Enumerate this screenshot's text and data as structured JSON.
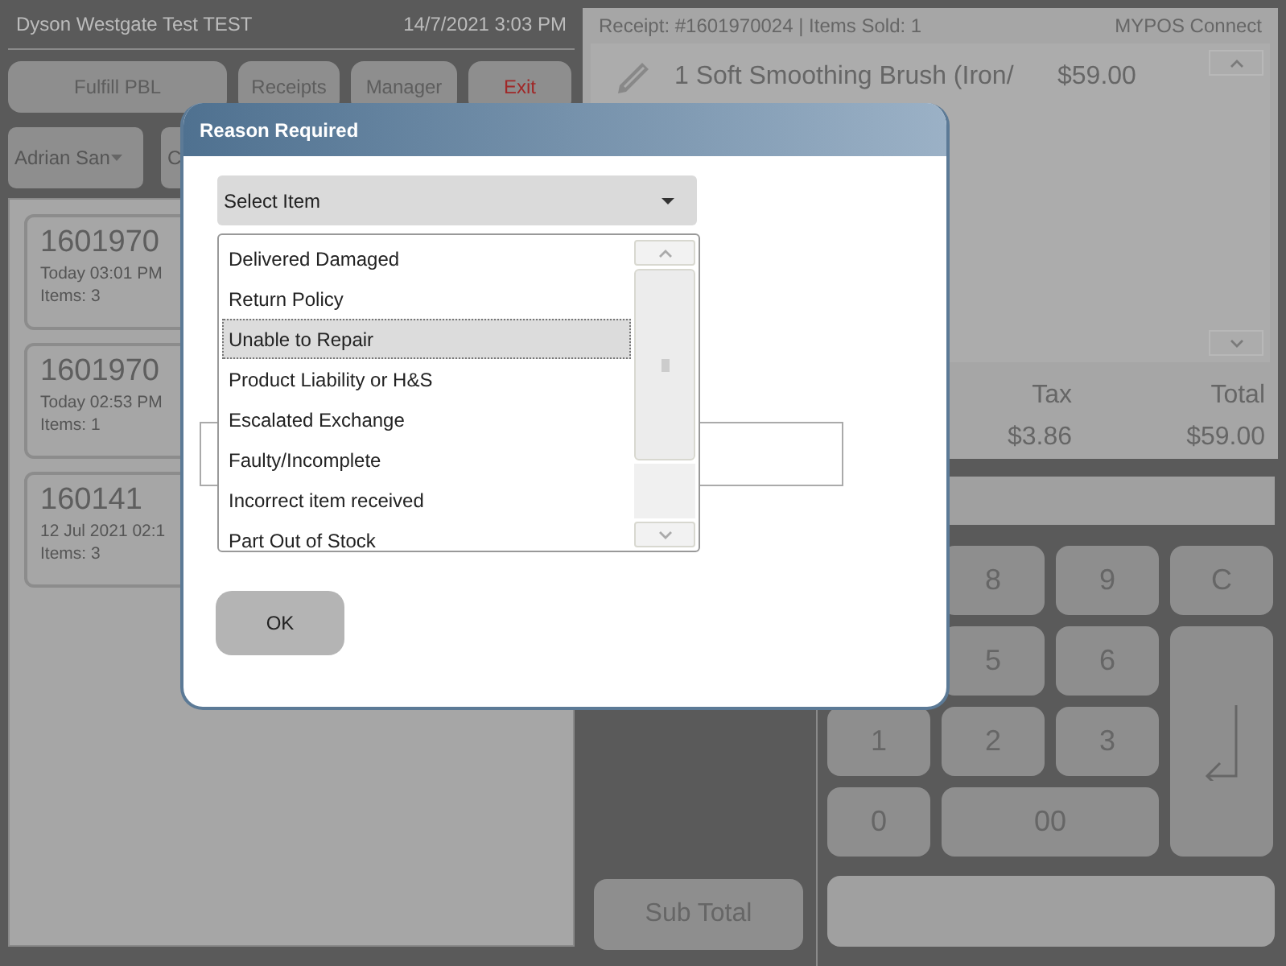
{
  "header": {
    "store": "Dyson Westgate Test TEST",
    "datetime": "14/7/2021 3:03 PM"
  },
  "toolbar": [
    {
      "label": "Fulfill PBL",
      "kind": "normal"
    },
    {
      "label": "Receipts",
      "kind": "normal"
    },
    {
      "label": "Manager",
      "kind": "normal"
    },
    {
      "label": "Exit",
      "kind": "danger"
    }
  ],
  "staff_dropdown": {
    "value": "Adrian San"
  },
  "second_button": {
    "label": "C"
  },
  "receipts": [
    {
      "number": "1601970",
      "time": "Today 03:01 PM",
      "items": "Items: 3"
    },
    {
      "number": "1601970",
      "time": "Today 02:53 PM",
      "items": "Items: 1"
    },
    {
      "number": "160141",
      "time": "12 Jul 2021 02:1",
      "items": "Items: 3"
    }
  ],
  "receipt_panel": {
    "header": "Receipt: #1601970024 | Items Sold: 1",
    "brand": "MYPOS Connect",
    "lines": [
      {
        "description": "1 Soft Smoothing Brush (Iron/",
        "price": "$59.00"
      }
    ],
    "totals": [
      {
        "label": "Tax",
        "value": "$3.86"
      },
      {
        "label": "Total",
        "value": "$59.00"
      }
    ]
  },
  "subtotal_button": {
    "label": "Sub Total"
  },
  "keypad": [
    {
      "label": "8",
      "kind": "digit"
    },
    {
      "label": "9",
      "kind": "digit"
    },
    {
      "label": "C",
      "kind": "digit"
    },
    {
      "label": "5",
      "kind": "digit"
    },
    {
      "label": "6",
      "kind": "digit"
    },
    {
      "kind": "enter"
    },
    {
      "label": "1",
      "kind": "digit"
    },
    {
      "label": "2",
      "kind": "digit"
    },
    {
      "label": "3",
      "kind": "digit"
    },
    {
      "label": "0",
      "kind": "digit"
    },
    {
      "label": "00",
      "kind": "wide"
    }
  ],
  "dialog": {
    "title": "Reason Required",
    "select": {
      "placeholder": "Select Item"
    },
    "options": [
      {
        "label": "Delivered Damaged",
        "selected": false
      },
      {
        "label": "Return Policy",
        "selected": false
      },
      {
        "label": "Unable to Repair",
        "selected": true
      },
      {
        "label": "Product Liability or H&S",
        "selected": false
      },
      {
        "label": "Escalated Exchange",
        "selected": false
      },
      {
        "label": "Faulty/Incomplete",
        "selected": false
      },
      {
        "label": "Incorrect item received",
        "selected": false
      },
      {
        "label": "Part Out of Stock",
        "selected": false
      }
    ],
    "ok": "OK"
  }
}
